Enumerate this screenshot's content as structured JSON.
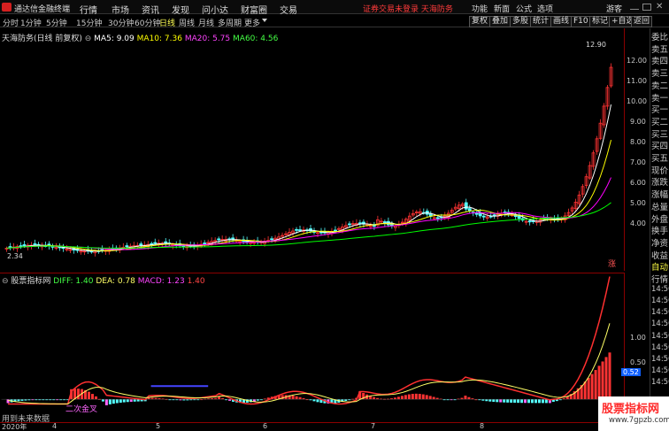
{
  "app": {
    "title": "通达信金融终端",
    "login_status": "证券交易未登录  天海防务"
  },
  "menu": [
    "行情",
    "市场",
    "资讯",
    "发现",
    "问小达",
    "财富圈",
    "交易"
  ],
  "right_menu": [
    "功能",
    "新面",
    "公式",
    "选项",
    "游客"
  ],
  "periods": [
    "分时",
    "1分钟",
    "5分钟",
    "15分钟",
    "30分钟",
    "60分钟",
    "日线",
    "周线",
    "月线",
    "多周期",
    "更多"
  ],
  "active_period": "日线",
  "right_tabs": [
    "复权",
    "叠加",
    "多股",
    "统计",
    "画线",
    "F10",
    "标记",
    "+自选",
    "返回"
  ],
  "main_legend": {
    "stock": "天海防务(日线 前复权)",
    "ma5": "MA5: 9.09",
    "ma10": "MA10: 7.36",
    "ma20": "MA20: 5.75",
    "ma60": "MA60: 4.56"
  },
  "price_axis": [
    "12.00",
    "11.00",
    "10.00",
    "9.00",
    "8.00",
    "7.00",
    "6.00",
    "5.00",
    "4.00"
  ],
  "high_label": "12.90",
  "low_label": "2.34",
  "ind_legend": {
    "name": "股票指标网",
    "diff": "DIFF: 1.40",
    "dea": "DEA: 0.78",
    "macd": "MACD: 1.23",
    "extra": "1.40"
  },
  "ind_axis": [
    "1.00",
    "0.50",
    "0.52"
  ],
  "annotation": "二次金叉",
  "footer_text": "用到未来数据",
  "time_labels": [
    "2020年",
    "4",
    "5",
    "6",
    "7",
    "8"
  ],
  "zhang_badge": "涨",
  "sidebar_items": [
    "委比",
    "卖五",
    "卖四",
    "卖三",
    "卖二",
    "卖一",
    "买一",
    "买二",
    "买三",
    "买四",
    "买五",
    "现价",
    "涨跌",
    "涨幅",
    "总量",
    "外盘",
    "换手",
    "净资",
    "收益",
    "自动",
    "行情",
    "14:50",
    "14:50",
    "14:50",
    "14:50",
    "14:50",
    "14:50",
    "14:50",
    "14:50",
    "14:50"
  ],
  "watermark": {
    "title": "股票指标网",
    "url": "www.7gpzb.com"
  },
  "colors": {
    "up": "#ff3333",
    "down": "#54ffff",
    "ma5": "#ffffff",
    "ma10": "#ffff00",
    "ma20": "#ff00ff",
    "ma60": "#00ff00"
  }
}
